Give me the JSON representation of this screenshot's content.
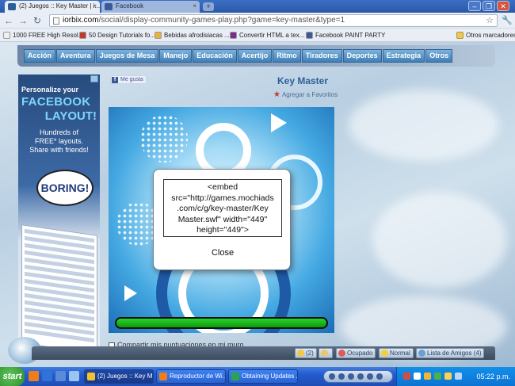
{
  "browser": {
    "tabs": [
      {
        "label": "(2) Juegos :: Key Master | i...",
        "favicon_color": "#2c5f97"
      },
      {
        "label": "Facebook",
        "favicon_color": "#3b5998"
      }
    ],
    "url_prefix": "iorbix.com",
    "url_rest": "/social/display-community-games-play.php?game=key-master&type=1",
    "bookmarks": [
      {
        "label": "1000 FREE High Resol...",
        "color": "#f0f0f0"
      },
      {
        "label": "50 Design Tutorials fo...",
        "color": "#c0392b"
      },
      {
        "label": "Bebidas afrodisiacas ...",
        "color": "#e9b03c"
      },
      {
        "label": "Convertir HTML a tex...",
        "color": "#7b2d8e"
      },
      {
        "label": "Facebook  PAINT PARTY",
        "color": "#3b5998"
      }
    ],
    "other_bookmarks": "Otros marcadores"
  },
  "site": {
    "menu": [
      "Acción",
      "Aventura",
      "Juegos de Mesa",
      "Manejo",
      "Educación",
      "Acertijo",
      "Ritmo",
      "Tiradores",
      "Deportes",
      "Estrategia",
      "Otros"
    ],
    "like_label": "Me gusta",
    "game_title": "Key Master",
    "favorites_label": "Agregar a Favoritos",
    "share_label": "Compartir mis puntuaciones en mi muro"
  },
  "ad": {
    "line1": "Personalize your",
    "line2": "FACEBOOK",
    "line3": "LAYOUT!",
    "line4": "Hundreds of\nFREE* layouts.\nShare with friends!",
    "bubble": "BORING!"
  },
  "dialog": {
    "embed_text": "<embed\nsrc=\"http://games.mochiads\n.com/c/g/key-master/Key\nMaster.swf\" width=\"449\"\nheight=\"449\">",
    "close_label": "Close"
  },
  "chatbar": {
    "notifications": "(2)",
    "status_busy": "Ocupado",
    "status_normal": "Normal",
    "friends": "Lista de Amigos (4)"
  },
  "taskbar": {
    "start_label": "start",
    "tasks": [
      {
        "label": "(2) Juegos :: Key M...",
        "active": true,
        "color": "#f2c12e"
      },
      {
        "label": "Reproductor de Wi...",
        "active": false,
        "color": "#f07d1b"
      },
      {
        "label": "Obtaining Updates ...",
        "active": false,
        "color": "#2fa24d"
      }
    ],
    "clock": "05:22 p.m."
  }
}
